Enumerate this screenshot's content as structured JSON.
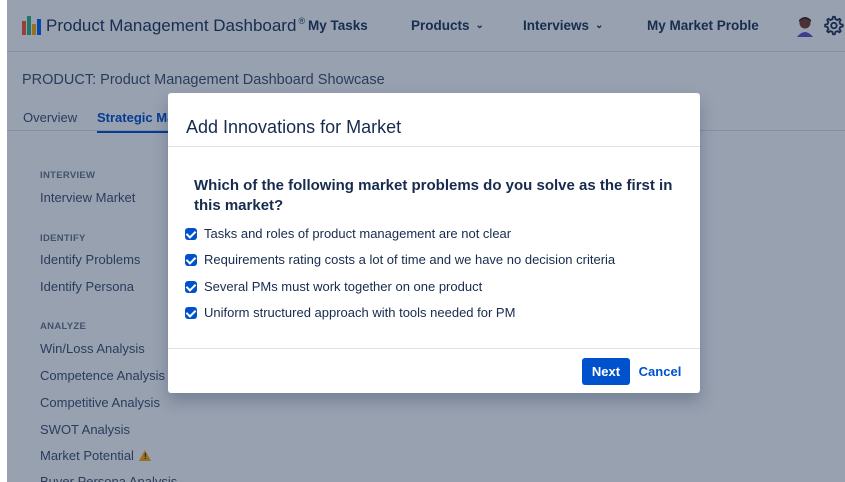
{
  "header": {
    "brand": "Product Management Dashboard",
    "brand_mark": "®",
    "nav": [
      {
        "label": "My Tasks"
      },
      {
        "label": "Products"
      },
      {
        "label": "Interviews"
      },
      {
        "label": "My Market Proble"
      }
    ],
    "chevron": "⌄",
    "icons": [
      "bar-chart-logo-icon",
      "avatar-icon",
      "gear-icon"
    ]
  },
  "page": {
    "product_title": "PRODUCT: Product Management Dashboard Showcase",
    "tabs": [
      {
        "label": "Overview"
      },
      {
        "label": "Strategic Ma"
      }
    ]
  },
  "sidebar": {
    "sections": [
      {
        "heading": "INTERVIEW",
        "items": [
          "Interview Market"
        ]
      },
      {
        "heading": "IDENTIFY",
        "items": [
          "Identify Problems",
          "Identify Persona"
        ]
      },
      {
        "heading": "ANALYZE",
        "items": [
          "Win/Loss Analysis",
          "Competence Analysis",
          "Competitive Analysis",
          "SWOT Analysis",
          "Market Potential",
          "Buyer Persona Analysis"
        ]
      }
    ],
    "warning_glyph": "!"
  },
  "modal": {
    "title": "Add Innovations for Market",
    "question": "Which of the following market problems do you solve as the first in this market?",
    "options": [
      {
        "label": "Tasks and roles of product management are not clear",
        "checked": true
      },
      {
        "label": "Requirements rating costs a lot of time and we have no decision criteria",
        "checked": true
      },
      {
        "label": "Several PMs must work together on one product",
        "checked": true
      },
      {
        "label": "Uniform structured approach with tools needed for PM",
        "checked": true
      }
    ],
    "next_label": "Next",
    "cancel_label": "Cancel"
  },
  "colors": {
    "accent": "#0052cc",
    "overlay": "#091e42",
    "warning": "#ffab00"
  }
}
